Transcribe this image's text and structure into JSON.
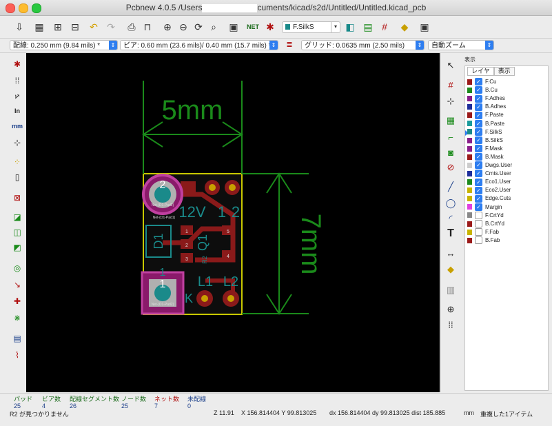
{
  "window": {
    "title_left": "Pcbnew 4.0.5 /Users",
    "title_right": "cuments/kicad/s2d/Untitled/Untitled.kicad_pcb"
  },
  "toolbar": {
    "layer_select": "F.SilkS"
  },
  "options": {
    "track_width": "配線: 0.250 mm (9.84 mils) *",
    "via_size": "ビア: 0.60 mm (23.6 mils)/ 0.40 mm (15.7 mils) *",
    "grid": "グリッド: 0.0635 mm (2.50 mils)",
    "zoom": "自動ズーム"
  },
  "canvas": {
    "dim_width": "5mm",
    "dim_height": "7mm",
    "pad2": "2",
    "pad1": "1",
    "lbl_12v": "12V",
    "lbl_1": "1",
    "lbl_2": "2",
    "lbl_q1": "Q1",
    "lbl_l1": "L1",
    "lbl_l2": "L2",
    "lbl_k": "K",
    "lbl_d1": "D1",
    "lbl_r2": "R2",
    "small_1": "1",
    "small_2": "2",
    "small_3": "3",
    "small_4": "4",
    "small_5": "5",
    "net_a": "Net-(D1-Pad2)",
    "net_b": "Net-(D1-Pad1)",
    "net_c": "Net-(D1-Pad2)"
  },
  "panel": {
    "header": "表示",
    "tab_layer": "レイヤ",
    "tab_render": "表示",
    "layers": [
      {
        "name": "F.Cu",
        "color": "#9b1a1a",
        "checked": true
      },
      {
        "name": "B.Cu",
        "color": "#1e8a1e",
        "checked": true
      },
      {
        "name": "F.Adhes",
        "color": "#8a1e8a",
        "checked": true
      },
      {
        "name": "B.Adhes",
        "color": "#1e2e9b",
        "checked": true
      },
      {
        "name": "F.Paste",
        "color": "#9b1a1a",
        "checked": true
      },
      {
        "name": "B.Paste",
        "color": "#1a9b9b",
        "checked": true
      },
      {
        "name": "F.SilkS",
        "color": "#1a8a8a",
        "checked": true
      },
      {
        "name": "B.SilkS",
        "color": "#8a1e8a",
        "checked": true
      },
      {
        "name": "F.Mask",
        "color": "#8a1e8a",
        "checked": true
      },
      {
        "name": "B.Mask",
        "color": "#9b1a1a",
        "checked": true
      },
      {
        "name": "Dwgs.User",
        "color": "#cccccc",
        "checked": true
      },
      {
        "name": "Cmts.User",
        "color": "#1e2e9b",
        "checked": true
      },
      {
        "name": "Eco1.User",
        "color": "#1e8a1e",
        "checked": true
      },
      {
        "name": "Eco2.User",
        "color": "#c8b400",
        "checked": true
      },
      {
        "name": "Edge.Cuts",
        "color": "#c8b400",
        "checked": true
      },
      {
        "name": "Margin",
        "color": "#e040e0",
        "checked": true
      },
      {
        "name": "F.CrtYd",
        "color": "#888888",
        "checked": false
      },
      {
        "name": "B.CrtYd",
        "color": "#9b1a1a",
        "checked": false
      },
      {
        "name": "F.Fab",
        "color": "#c8b400",
        "checked": false
      },
      {
        "name": "B.Fab",
        "color": "#9b1a1a",
        "checked": false
      }
    ]
  },
  "status": {
    "pads_label": "パッド",
    "pads": "25",
    "vias_label": "ビア数",
    "vias": "4",
    "segments_label": "配線セグメント数",
    "segments": "26",
    "nodes_label": "ノード数",
    "nodes": "25",
    "nets_label": "ネット数",
    "nets": "7",
    "unrouted_label": "未配線",
    "unrouted": "0",
    "message": "R2 が見つかりません",
    "zoom": "Z 11.91",
    "xy": "X 156.814404  Y 99.813025",
    "dxy": "dx 156.814404  dy 99.813025  dist 185.885",
    "units": "mm",
    "selection": "重複した1アイテム"
  }
}
